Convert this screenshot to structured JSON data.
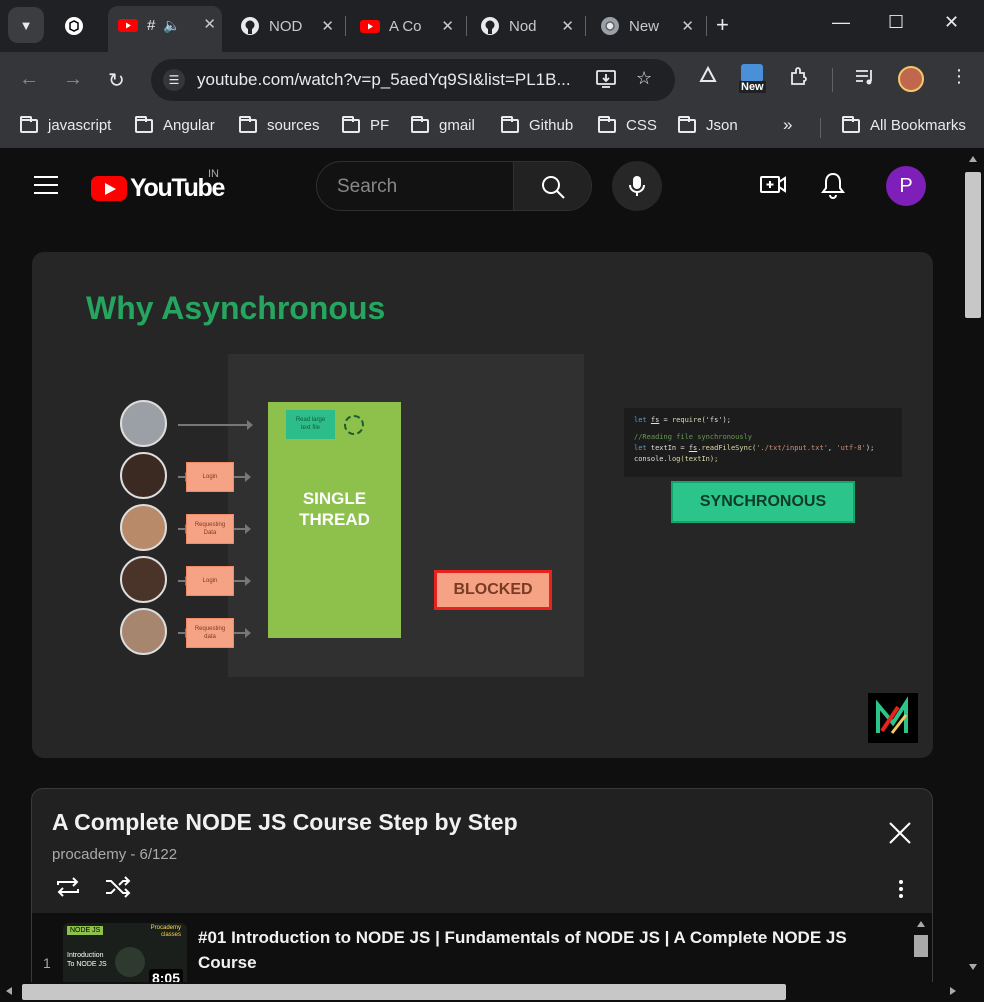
{
  "browser": {
    "tabs": [
      {
        "title": "",
        "favicon": "chatgpt-icon"
      },
      {
        "title": "#",
        "favicon": "youtube-icon",
        "audio": true
      },
      {
        "title": "NOD",
        "favicon": "github-icon"
      },
      {
        "title": "A Co",
        "favicon": "youtube-icon"
      },
      {
        "title": "Nod",
        "favicon": "github-icon"
      },
      {
        "title": "New",
        "favicon": "chrome-icon"
      }
    ],
    "url": "youtube.com/watch?v=p_5aedYq9SI&list=PL1B...",
    "ext_badge": "New",
    "bookmarks": [
      "javascript",
      "Angular",
      "sources",
      "PF",
      "gmail",
      "Github",
      "CSS",
      "Json"
    ],
    "bookmarks_overflow": "»",
    "all_bookmarks": "All Bookmarks"
  },
  "youtube": {
    "logo_text": "YouTube",
    "country": "IN",
    "search_placeholder": "Search",
    "avatar_letter": "P",
    "colors": {
      "brand": "#ff0000",
      "avatar": "#7d1fb8"
    }
  },
  "video": {
    "slide_title": "Why Asynchronous",
    "thread_label_1": "SINGLE",
    "thread_label_2": "THREAD",
    "read_file_label_1": "Read large",
    "read_file_label_2": "text file",
    "requests": [
      {
        "label_1": "Login",
        "label_2": ""
      },
      {
        "label_1": "Requesting",
        "label_2": "Data"
      },
      {
        "label_1": "Login",
        "label_2": ""
      },
      {
        "label_1": "Requesting",
        "label_2": "data"
      }
    ],
    "blocked_label": "BLOCKED",
    "code_lines": {
      "l1a": "let ",
      "l1b": "fs",
      "l1c": " = ",
      "l1d": "require",
      "l1e": "('fs');",
      "l2": "//Reading file synchronously",
      "l3a": "let ",
      "l3b": "textIn",
      "l3c": " = ",
      "l3d": "fs",
      "l3e": ".readFileSync(",
      "l3f": "'./txt/input.txt'",
      "l3g": ", ",
      "l3h": "'utf-8'",
      "l3i": ");",
      "l4a": "console",
      "l4b": ".log(textIn);"
    },
    "sync_label": "SYNCHRONOUS"
  },
  "playlist": {
    "title": "A Complete NODE JS Course Step by Step",
    "subtitle": "procademy - 6/122",
    "items": [
      {
        "index": "1",
        "title": "#01 Introduction to NODE JS | Fundamentals of NODE JS | A Complete NODE JS Course",
        "duration": "8:05",
        "thumb_badge": "NODE JS",
        "thumb_badge2_1": "Procademy",
        "thumb_badge2_2": "classes",
        "thumb_text_1": "Introduction",
        "thumb_text_2": "To NODE JS"
      }
    ]
  }
}
